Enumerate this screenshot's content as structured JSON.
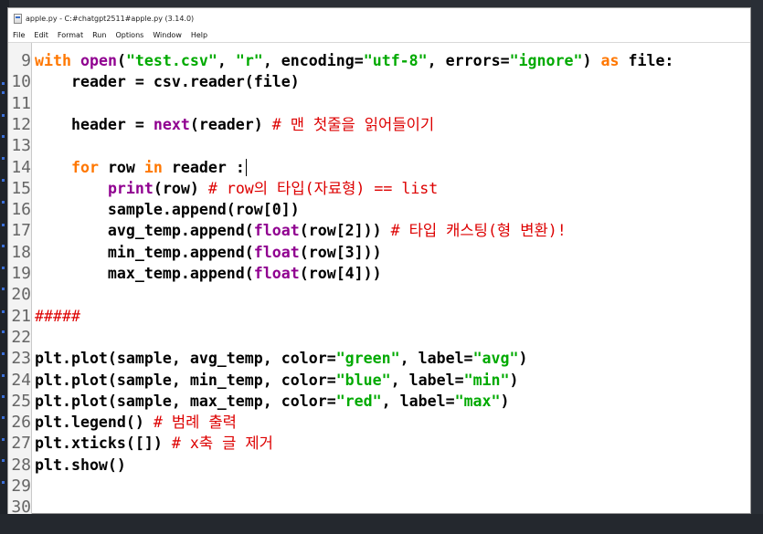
{
  "window": {
    "title": "apple.py - C:#chatgpt2511#apple.py (3.14.0)"
  },
  "menu": [
    "File",
    "Edit",
    "Format",
    "Run",
    "Options",
    "Window",
    "Help"
  ],
  "colors": {
    "keyword": "#ff7700",
    "string": "#00aa00",
    "builtin": "#900090",
    "comment": "#dd0000",
    "gutter": "#f3f3f3"
  },
  "editor": {
    "line_numbers": [
      "9",
      "10",
      "11",
      "12",
      "13",
      "14",
      "15",
      "16",
      "17",
      "18",
      "19",
      "20",
      "21",
      "22",
      "23",
      "24",
      "25",
      "26",
      "27",
      "28",
      "29",
      "30"
    ],
    "lines": [
      [
        {
          "t": "with",
          "c": "kw"
        },
        {
          "t": " "
        },
        {
          "t": "open",
          "c": "bi"
        },
        {
          "t": "("
        },
        {
          "t": "\"test.csv\"",
          "c": "str"
        },
        {
          "t": ", "
        },
        {
          "t": "\"r\"",
          "c": "str"
        },
        {
          "t": ", encoding="
        },
        {
          "t": "\"utf-8\"",
          "c": "str"
        },
        {
          "t": ", errors="
        },
        {
          "t": "\"ignore\"",
          "c": "str"
        },
        {
          "t": ") "
        },
        {
          "t": "as",
          "c": "kw"
        },
        {
          "t": " file:"
        }
      ],
      [
        {
          "t": "    reader = csv.reader(file)"
        }
      ],
      [],
      [
        {
          "t": "    header = "
        },
        {
          "t": "next",
          "c": "bi"
        },
        {
          "t": "(reader) "
        },
        {
          "t": "# 맨 첫줄을 읽어들이기",
          "c": "cm"
        }
      ],
      [],
      [
        {
          "t": "    "
        },
        {
          "t": "for",
          "c": "kw"
        },
        {
          "t": " row "
        },
        {
          "t": "in",
          "c": "kw"
        },
        {
          "t": " reader :"
        }
      ],
      [
        {
          "t": "        "
        },
        {
          "t": "print",
          "c": "bi"
        },
        {
          "t": "(row) "
        },
        {
          "t": "# row의 타입(자료형) == list",
          "c": "cm"
        }
      ],
      [
        {
          "t": "        sample.append(row[0])"
        }
      ],
      [
        {
          "t": "        avg_temp.append("
        },
        {
          "t": "float",
          "c": "bi"
        },
        {
          "t": "(row[2])) "
        },
        {
          "t": "# 타입 캐스팅(형 변환)!",
          "c": "cm"
        }
      ],
      [
        {
          "t": "        min_temp.append("
        },
        {
          "t": "float",
          "c": "bi"
        },
        {
          "t": "(row[3]))"
        }
      ],
      [
        {
          "t": "        max_temp.append("
        },
        {
          "t": "float",
          "c": "bi"
        },
        {
          "t": "(row[4]))"
        }
      ],
      [],
      [
        {
          "t": "#####",
          "c": "cm"
        }
      ],
      [],
      [
        {
          "t": "plt.plot(sample, avg_temp, color="
        },
        {
          "t": "\"green\"",
          "c": "str"
        },
        {
          "t": ", label="
        },
        {
          "t": "\"avg\"",
          "c": "str"
        },
        {
          "t": ")"
        }
      ],
      [
        {
          "t": "plt.plot(sample, min_temp, color="
        },
        {
          "t": "\"blue\"",
          "c": "str"
        },
        {
          "t": ", label="
        },
        {
          "t": "\"min\"",
          "c": "str"
        },
        {
          "t": ")"
        }
      ],
      [
        {
          "t": "plt.plot(sample, max_temp, color="
        },
        {
          "t": "\"red\"",
          "c": "str"
        },
        {
          "t": ", label="
        },
        {
          "t": "\"max\"",
          "c": "str"
        },
        {
          "t": ")"
        }
      ],
      [
        {
          "t": "plt.legend() "
        },
        {
          "t": "# 범례 출력",
          "c": "cm"
        }
      ],
      [
        {
          "t": "plt.xticks([]) "
        },
        {
          "t": "# x축 글 제거",
          "c": "cm"
        }
      ],
      [
        {
          "t": "plt.show()"
        }
      ],
      [],
      []
    ]
  }
}
